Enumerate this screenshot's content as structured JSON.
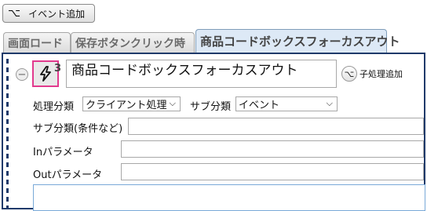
{
  "toolbar": {
    "add_event_label": "イベント追加",
    "add_event_icon": "branch-icon"
  },
  "tabs": [
    {
      "label": "画面ロード"
    },
    {
      "label": "保存ボタンクリック時"
    },
    {
      "label": "商品コードボックスフォーカスアウト",
      "active": true
    }
  ],
  "event": {
    "step_number": "3",
    "title": "商品コードボックスフォーカスアウト",
    "add_child_label": "子処理追加",
    "processing_category_label": "処理分類",
    "processing_category_value": "クライアント処理",
    "sub_category_label": "サブ分類",
    "sub_category_value": "イベント",
    "sub_category_condition_label": "サブ分類(条件など)",
    "sub_category_condition_value": "",
    "in_param_label": "Inパラメータ",
    "in_param_value": "",
    "out_param_label": "Outパラメータ",
    "out_param_value": ""
  },
  "colors": {
    "panel_border": "#1f3a6a",
    "highlight_border": "#e23a8e",
    "active_tab_bg": "#dde9f6"
  }
}
